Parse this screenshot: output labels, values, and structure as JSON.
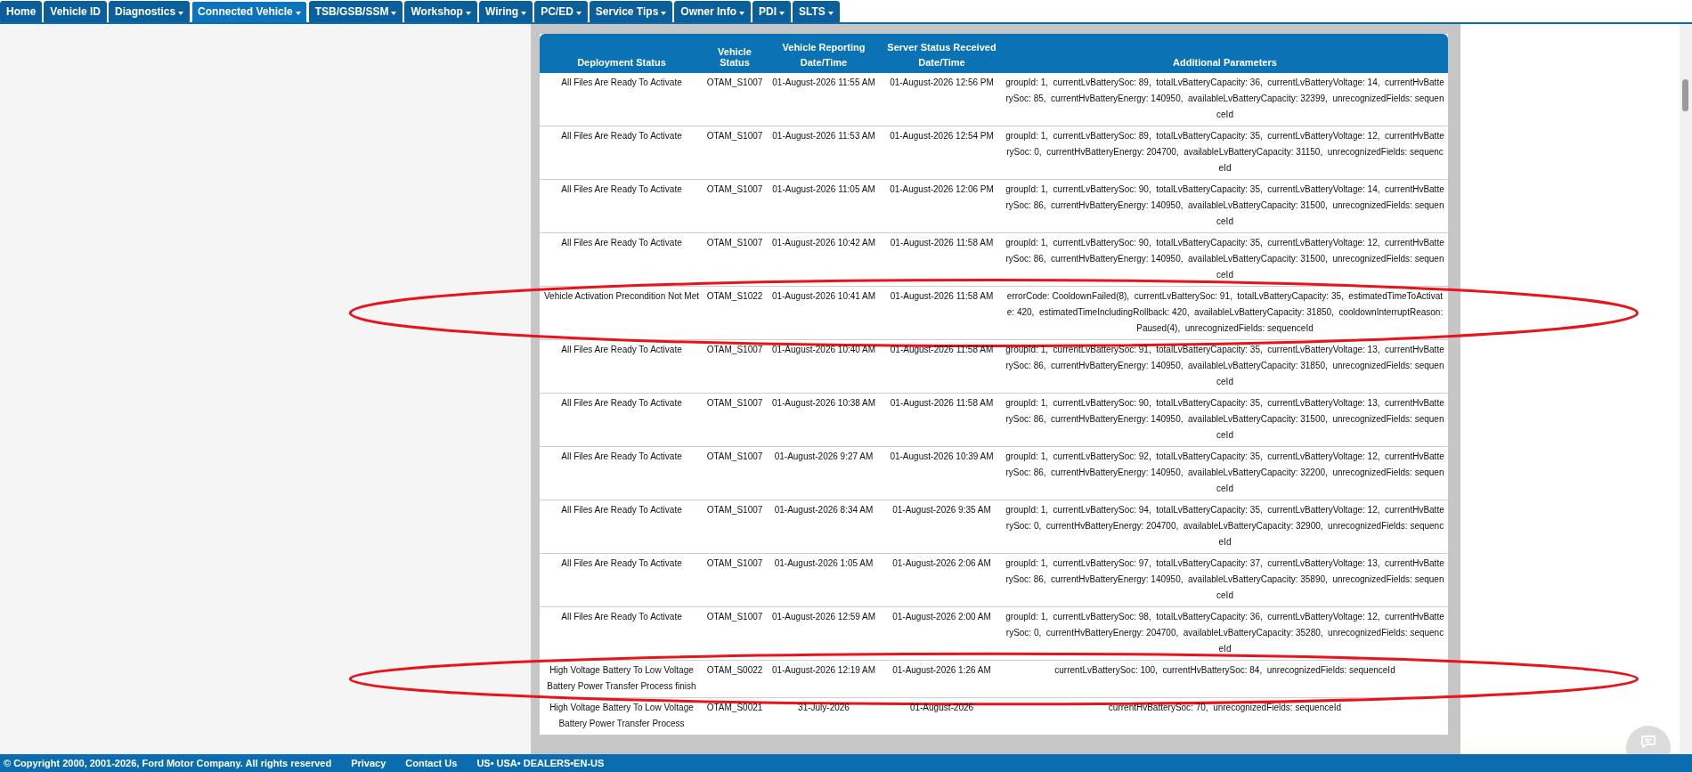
{
  "nav": {
    "tabs": [
      {
        "label": "Home",
        "dropdown": false,
        "selected": false
      },
      {
        "label": "Vehicle ID",
        "dropdown": false,
        "selected": false
      },
      {
        "label": "Diagnostics",
        "dropdown": true,
        "selected": false
      },
      {
        "label": "Connected Vehicle",
        "dropdown": true,
        "selected": true
      },
      {
        "label": "TSB/GSB/SSM",
        "dropdown": true,
        "selected": false
      },
      {
        "label": "Workshop",
        "dropdown": true,
        "selected": false
      },
      {
        "label": "Wiring",
        "dropdown": true,
        "selected": false
      },
      {
        "label": "PC/ED",
        "dropdown": true,
        "selected": false
      },
      {
        "label": "Service Tips",
        "dropdown": true,
        "selected": false
      },
      {
        "label": "Owner Info",
        "dropdown": true,
        "selected": false
      },
      {
        "label": "PDI",
        "dropdown": true,
        "selected": false
      },
      {
        "label": "SLTS",
        "dropdown": true,
        "selected": false
      }
    ]
  },
  "table": {
    "columns": [
      {
        "label": "Deployment Status"
      },
      {
        "label": "Vehicle Status"
      },
      {
        "group": "Vehicle Reporting",
        "label": "Date/Time"
      },
      {
        "group": "Server Status Received",
        "label": "Date/Time"
      },
      {
        "label": "Additional Parameters"
      }
    ],
    "rows": [
      {
        "deployment_status": "All Files Are Ready To Activate",
        "vehicle_status": "OTAM_S1007",
        "reporting_datetime": "01-August-2026 11:55 AM",
        "server_datetime": "01-August-2026 12:56 PM",
        "additional_parameters": "groupId: 1,  currentLvBatterySoc: 89,  totalLvBatteryCapacity: 36,  currentLvBatteryVoltage: 14,  currentHvBatterySoc: 85,  currentHvBatteryEnergy: 140950,  availableLvBatteryCapacity: 32399,  unrecognizedFields: sequenceId",
        "circled": false
      },
      {
        "deployment_status": "All Files Are Ready To Activate",
        "vehicle_status": "OTAM_S1007",
        "reporting_datetime": "01-August-2026 11:53 AM",
        "server_datetime": "01-August-2026 12:54 PM",
        "additional_parameters": "groupId: 1,  currentLvBatterySoc: 89,  totalLvBatteryCapacity: 35,  currentLvBatteryVoltage: 12,  currentHvBatterySoc: 0,  currentHvBatteryEnergy: 204700,  availableLvBatteryCapacity: 31150,  unrecognizedFields: sequenceId",
        "circled": false
      },
      {
        "deployment_status": "All Files Are Ready To Activate",
        "vehicle_status": "OTAM_S1007",
        "reporting_datetime": "01-August-2026 11:05 AM",
        "server_datetime": "01-August-2026 12:06 PM",
        "additional_parameters": "groupId: 1,  currentLvBatterySoc: 90,  totalLvBatteryCapacity: 35,  currentLvBatteryVoltage: 14,  currentHvBatterySoc: 86,  currentHvBatteryEnergy: 140950,  availableLvBatteryCapacity: 31500,  unrecognizedFields: sequenceId",
        "circled": false
      },
      {
        "deployment_status": "All Files Are Ready To Activate",
        "vehicle_status": "OTAM_S1007",
        "reporting_datetime": "01-August-2026 10:42 AM",
        "server_datetime": "01-August-2026 11:58 AM",
        "additional_parameters": "groupId: 1,  currentLvBatterySoc: 90,  totalLvBatteryCapacity: 35,  currentLvBatteryVoltage: 12,  currentHvBatterySoc: 86,  currentHvBatteryEnergy: 140950,  availableLvBatteryCapacity: 31500,  unrecognizedFields: sequenceId",
        "circled": false
      },
      {
        "deployment_status": "Vehicle Activation Precondition Not Met",
        "vehicle_status": "OTAM_S1022",
        "reporting_datetime": "01-August-2026 10:41 AM",
        "server_datetime": "01-August-2026 11:58 AM",
        "additional_parameters": "errorCode: CooldownFailed(8),  currentLvBatterySoc: 91,  totalLvBatteryCapacity: 35,  estimatedTimeToActivate: 420,  estimatedTimeIncludingRollback: 420,  availableLvBatteryCapacity: 31850,  cooldownInterruptReason: Paused(4),  unrecognizedFields: sequenceId",
        "circled": true
      },
      {
        "deployment_status": "All Files Are Ready To Activate",
        "vehicle_status": "OTAM_S1007",
        "reporting_datetime": "01-August-2026 10:40 AM",
        "server_datetime": "01-August-2026 11:58 AM",
        "additional_parameters": "groupId: 1,  currentLvBatterySoc: 91,  totalLvBatteryCapacity: 35,  currentLvBatteryVoltage: 13,  currentHvBatterySoc: 86,  currentHvBatteryEnergy: 140950,  availableLvBatteryCapacity: 31850,  unrecognizedFields: sequenceId",
        "circled": false
      },
      {
        "deployment_status": "All Files Are Ready To Activate",
        "vehicle_status": "OTAM_S1007",
        "reporting_datetime": "01-August-2026 10:38 AM",
        "server_datetime": "01-August-2026 11:58 AM",
        "additional_parameters": "groupId: 1,  currentLvBatterySoc: 90,  totalLvBatteryCapacity: 35,  currentLvBatteryVoltage: 13,  currentHvBatterySoc: 86,  currentHvBatteryEnergy: 140950,  availableLvBatteryCapacity: 31500,  unrecognizedFields: sequenceId",
        "circled": false
      },
      {
        "deployment_status": "All Files Are Ready To Activate",
        "vehicle_status": "OTAM_S1007",
        "reporting_datetime": "01-August-2026 9:27 AM",
        "server_datetime": "01-August-2026 10:39 AM",
        "additional_parameters": "groupId: 1,  currentLvBatterySoc: 92,  totalLvBatteryCapacity: 35,  currentLvBatteryVoltage: 12,  currentHvBatterySoc: 86,  currentHvBatteryEnergy: 140950,  availableLvBatteryCapacity: 32200,  unrecognizedFields: sequenceId",
        "circled": false
      },
      {
        "deployment_status": "All Files Are Ready To Activate",
        "vehicle_status": "OTAM_S1007",
        "reporting_datetime": "01-August-2026 8:34 AM",
        "server_datetime": "01-August-2026 9:35 AM",
        "additional_parameters": "groupId: 1,  currentLvBatterySoc: 94,  totalLvBatteryCapacity: 35,  currentLvBatteryVoltage: 12,  currentHvBatterySoc: 0,  currentHvBatteryEnergy: 204700,  availableLvBatteryCapacity: 32900,  unrecognizedFields: sequenceId",
        "circled": false
      },
      {
        "deployment_status": "All Files Are Ready To Activate",
        "vehicle_status": "OTAM_S1007",
        "reporting_datetime": "01-August-2026 1:05 AM",
        "server_datetime": "01-August-2026 2:06 AM",
        "additional_parameters": "groupId: 1,  currentLvBatterySoc: 97,  totalLvBatteryCapacity: 37,  currentLvBatteryVoltage: 13,  currentHvBatterySoc: 86,  currentHvBatteryEnergy: 140950,  availableLvBatteryCapacity: 35890,  unrecognizedFields: sequenceId",
        "circled": false
      },
      {
        "deployment_status": "All Files Are Ready To Activate",
        "vehicle_status": "OTAM_S1007",
        "reporting_datetime": "01-August-2026 12:59 AM",
        "server_datetime": "01-August-2026 2:00 AM",
        "additional_parameters": "groupId: 1,  currentLvBatterySoc: 98,  totalLvBatteryCapacity: 36,  currentLvBatteryVoltage: 12,  currentHvBatterySoc: 0,  currentHvBatteryEnergy: 204700,  availableLvBatteryCapacity: 35280,  unrecognizedFields: sequenceId",
        "circled": false
      },
      {
        "deployment_status": "High Voltage Battery To Low Voltage Battery Power Transfer Process finish",
        "vehicle_status": "OTAM_S0022",
        "reporting_datetime": "01-August-2026 12:19 AM",
        "server_datetime": "01-August-2026 1:26 AM",
        "additional_parameters": "currentLvBatterySoc: 100,  currentHvBatterySoc: 84,  unrecognizedFields: sequenceId",
        "circled": true
      },
      {
        "deployment_status": "High Voltage Battery To Low Voltage Battery Power Transfer Process",
        "vehicle_status": "OTAM_S0021",
        "reporting_datetime": "31-July-2026",
        "server_datetime": "01-August-2026",
        "additional_parameters": "currentHvBatterySoc: 70,  unrecognizedFields: sequenceId",
        "circled": false
      }
    ]
  },
  "footer": {
    "copyright": "© Copyright 2000, 2001-2026, Ford Motor Company. All rights reserved",
    "links": [
      "Privacy",
      "Contact Us",
      "US• USA• DEALERS•EN-US"
    ]
  }
}
